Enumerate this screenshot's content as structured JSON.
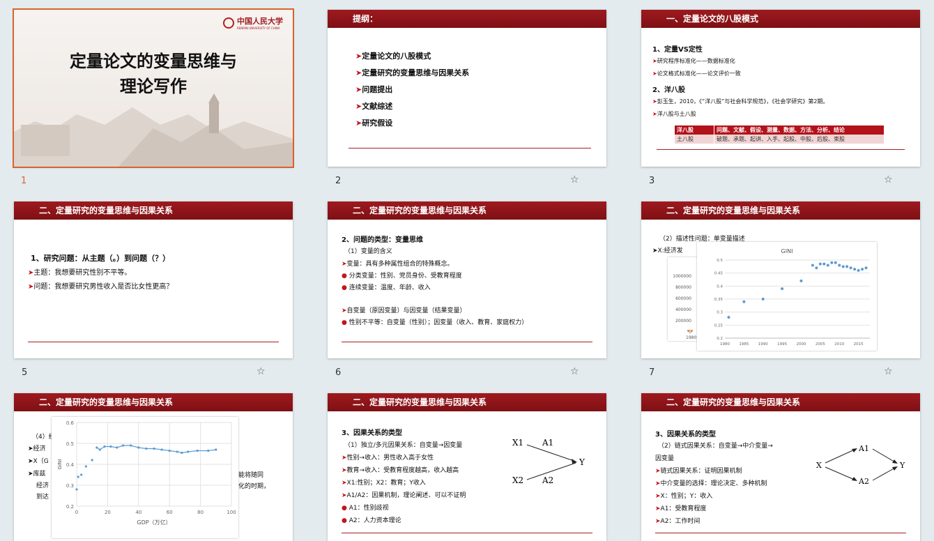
{
  "slides": [
    {
      "num": "1",
      "title_line1": "定量论文的变量思维与",
      "title_line2": "理论写作",
      "logo_cn": "中国人民大学",
      "logo_en": "RENMIN UNIVERSITY OF CHINA"
    },
    {
      "num": "2",
      "header": "提纲：",
      "items": [
        "定量论文的八股模式",
        "定量研究的变量思维与因果关系",
        "问题提出",
        "文献综述",
        "研究假设"
      ]
    },
    {
      "num": "3",
      "header": "一、定量论文的八股模式",
      "h1": "1、定量VS定性",
      "b1": "研究程序标准化——数据标准化",
      "b2": "论文格式标准化——论文评价一致",
      "h2": "2、洋八股",
      "b3": "彭玉生，2010，《“洋八股”与社会科学规范》，《社会学研究》第2期。",
      "b4": "洋八股与土八股",
      "table": [
        [
          "洋八股",
          "问题、文献、假设、测量、数据、方法、分析、结论"
        ],
        [
          "土八股",
          "破题、承题、起讲、入手、起股、中股、后股、束股"
        ]
      ]
    },
    {
      "num": "5",
      "header": "二、定量研究的变量思维与因果关系",
      "h1": "1、研究问题：从主题（。）到问题（？）",
      "b1": "主题：我想要研究性别不平等。",
      "b2": "问题：我想要研究男性收入是否比女性更高？"
    },
    {
      "num": "6",
      "header": "二、定量研究的变量思维与因果关系",
      "h1": "2、问题的类型：变量思维",
      "l1": "（1）变量的含义",
      "l2": "变量：具有多种属性组合的特殊概念。",
      "l3": "分类变量：性别、党员身份、受教育程度",
      "l4": "连续变量：温度、年龄、收入",
      "l5": "自变量（原因变量）与因变量（结果变量）",
      "l6": "性别不平等：自变量（性别）；因变量（收入、教育、家庭权力）"
    },
    {
      "num": "7",
      "header": "二、定量研究的变量思维与因果关系",
      "l1": "（2）描述性问题：单变量描述",
      "l2": "X:经济发",
      "chart_title": "GINI",
      "back_y": [
        "1000000",
        "800000",
        "600000",
        "400000",
        "200000",
        "0"
      ],
      "back_x": "1980",
      "chart_data": {
        "type": "scatter",
        "title": "GINI",
        "x": [
          1981,
          1985,
          1990,
          1995,
          2000,
          2003,
          2004,
          2005,
          2006,
          2007,
          2008,
          2009,
          2010,
          2011,
          2012,
          2013,
          2014,
          2015,
          2016,
          2017
        ],
        "y": [
          0.28,
          0.34,
          0.35,
          0.39,
          0.42,
          0.48,
          0.47,
          0.485,
          0.485,
          0.48,
          0.49,
          0.49,
          0.48,
          0.475,
          0.475,
          0.47,
          0.465,
          0.46,
          0.465,
          0.47
        ],
        "xlim": [
          1980,
          2018
        ],
        "ylim": [
          0.2,
          0.5
        ],
        "xticks": [
          "1980",
          "1985",
          "1990",
          "1995",
          "2000",
          "2005",
          "2010",
          "2015"
        ],
        "yticks": [
          "0.5",
          "0.45",
          "0.4",
          "0.35",
          "0.3",
          "0.25",
          "0.2"
        ]
      }
    },
    {
      "num": "",
      "header": "二、定量研究的变量思维与因果关系",
      "l1": "（4）经",
      "l2": "经济",
      "l3": "X（G",
      "l4": "库兹",
      "l5": "经济",
      "l6": "到达",
      "r1": "能将随同",
      "r2": "化的时期，",
      "chart_data": {
        "type": "line",
        "xlabel": "GDP（万亿）",
        "ylabel": "GINI",
        "x": [
          0,
          1,
          3,
          6,
          10,
          13,
          15,
          18,
          22,
          26,
          30,
          35,
          40,
          45,
          50,
          55,
          60,
          65,
          68,
          72,
          78,
          85,
          90
        ],
        "y": [
          0.28,
          0.34,
          0.35,
          0.39,
          0.42,
          0.48,
          0.47,
          0.485,
          0.485,
          0.48,
          0.49,
          0.49,
          0.48,
          0.475,
          0.475,
          0.47,
          0.465,
          0.46,
          0.455,
          0.46,
          0.465,
          0.465,
          0.47
        ],
        "xlim": [
          0,
          100
        ],
        "ylim": [
          0.2,
          0.6
        ],
        "xticks": [
          "0",
          "20",
          "40",
          "60",
          "80",
          "100"
        ],
        "yticks": [
          "0.6",
          "0.5",
          "0.4",
          "0.3",
          "0.2"
        ]
      }
    },
    {
      "num": "",
      "header": "二、定量研究的变量思维与因果关系",
      "h1": "3、因果关系的类型",
      "l1": "（1）独立/多元因果关系：自变量→因变量",
      "l2": "性别→收入：男性收入高于女性",
      "l3": "教育→收入：受教育程度越高，收入越高",
      "l4": "X1:性别；X2：教育；Y收入",
      "l5": "A1/A2：因果机制，理论阐述、可以不证明",
      "l6": "A1：性别歧视",
      "l7": "A2：人力资本理论",
      "d": {
        "x1": "X1",
        "x2": "X2",
        "a1": "A1",
        "a2": "A2",
        "y": "Y"
      }
    },
    {
      "num": "",
      "header": "二、定量研究的变量思维与因果关系",
      "h1": "3、因果关系的类型",
      "l1": "（2）链式因果关系：自变量→中介变量→",
      "l1b": "因变量",
      "l2": "链式因果关系：证明因果机制",
      "l3": "中介变量的选择：理论决定、多种机制",
      "l4": "X：性别；Y：收入",
      "l5": "A1：受教育程度",
      "l6": "A2：工作时间",
      "d": {
        "x": "X",
        "a1": "A1",
        "a2": "A2",
        "y": "Y"
      }
    }
  ]
}
